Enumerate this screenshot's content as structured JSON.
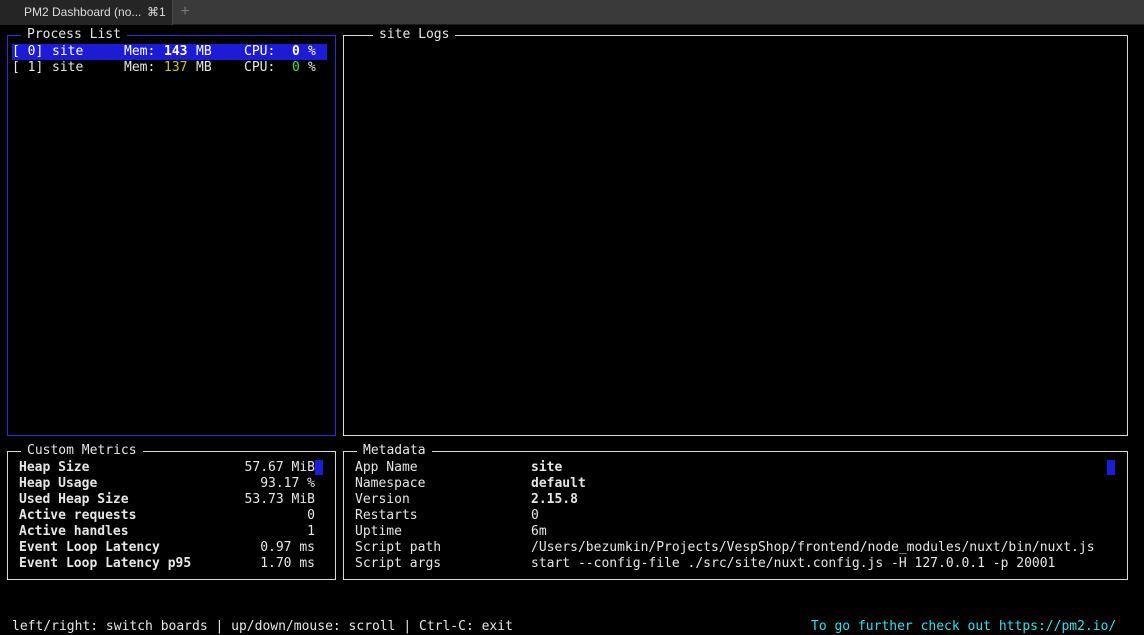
{
  "window": {
    "tab_title": "PM2 Dashboard (no...",
    "tab_shortcut": "⌘1",
    "new_tab": "+"
  },
  "process_list": {
    "title": "Process List",
    "mem_label": "Mem:",
    "cpu_label": "CPU:",
    "items": [
      {
        "id": "[ 0]",
        "name": "site",
        "mem": "143",
        "mem_unit": "MB",
        "cpu": "0",
        "cpu_unit": "%"
      },
      {
        "id": "[ 1]",
        "name": "site",
        "mem": "137",
        "mem_unit": "MB",
        "cpu": "0",
        "cpu_unit": "%"
      }
    ]
  },
  "logs": {
    "title": "site Logs"
  },
  "custom_metrics": {
    "title": "Custom Metrics",
    "rows": [
      {
        "label": "Heap Size",
        "value": "57.67 MiB"
      },
      {
        "label": "Heap Usage",
        "value": "93.17 %"
      },
      {
        "label": "Used Heap Size",
        "value": "53.73 MiB"
      },
      {
        "label": "Active requests",
        "value": "0"
      },
      {
        "label": "Active handles",
        "value": "1"
      },
      {
        "label": "Event Loop Latency",
        "value": "0.97 ms"
      },
      {
        "label": "Event Loop Latency p95",
        "value": "1.70 ms"
      }
    ]
  },
  "metadata": {
    "title": "Metadata",
    "rows": [
      {
        "key": "App Name",
        "value": "site"
      },
      {
        "key": "Namespace",
        "value": "default"
      },
      {
        "key": "Version",
        "value": "2.15.8"
      },
      {
        "key": "Restarts",
        "value": "0"
      },
      {
        "key": "Uptime",
        "value": "6m"
      },
      {
        "key": "Script path",
        "value": "/Users/bezumkin/Projects/VespShop/frontend/node_modules/nuxt/bin/nuxt.js"
      },
      {
        "key": "Script args",
        "value": "start --config-file ./src/site/nuxt.config.js -H 127.0.0.1 -p 20001"
      }
    ]
  },
  "footer": {
    "help": "left/right: switch boards | up/down/mouse: scroll | Ctrl-C: exit",
    "link": "To go further check out https://pm2.io/"
  }
}
